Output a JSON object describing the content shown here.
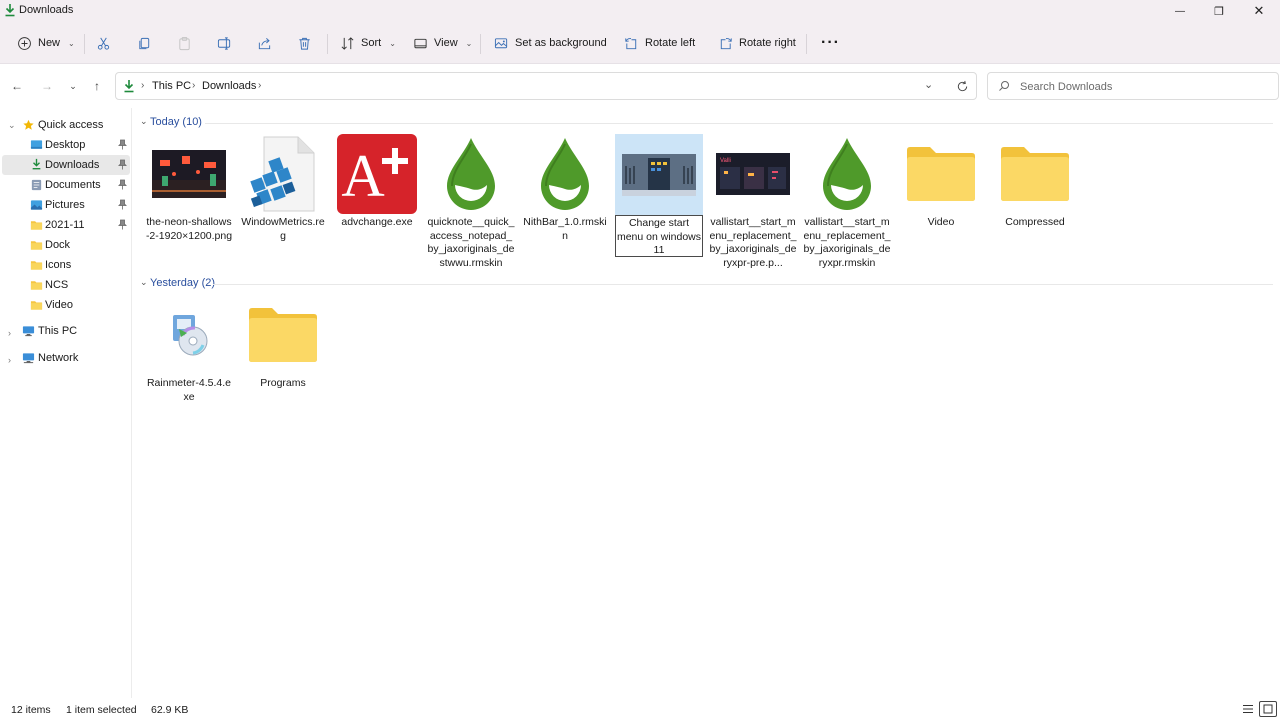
{
  "window": {
    "title": "Downloads",
    "minimize_glyph": "—",
    "maximize_glyph": "❐",
    "close_glyph": "✕"
  },
  "toolbar": {
    "new_label": "New",
    "sort_label": "Sort",
    "view_label": "View",
    "set_background_label": "Set as background",
    "rotate_left_label": "Rotate left",
    "rotate_right_label": "Rotate right",
    "more_label": "···"
  },
  "address": {
    "crumbs": [
      "This PC",
      "Downloads"
    ],
    "search_placeholder": "Search Downloads"
  },
  "sidebar": {
    "quick_access": "Quick access",
    "items": [
      {
        "label": "Desktop",
        "icon": "desktop-icon",
        "pinned": true
      },
      {
        "label": "Downloads",
        "icon": "downloads-icon",
        "pinned": true,
        "selected": true
      },
      {
        "label": "Documents",
        "icon": "documents-icon",
        "pinned": true
      },
      {
        "label": "Pictures",
        "icon": "pictures-icon",
        "pinned": true
      },
      {
        "label": "2021-11",
        "icon": "folder-icon",
        "pinned": true
      },
      {
        "label": "Dock",
        "icon": "folder-icon",
        "pinned": false
      },
      {
        "label": "Icons",
        "icon": "folder-icon",
        "pinned": false
      },
      {
        "label": "NCS",
        "icon": "folder-icon",
        "pinned": false
      },
      {
        "label": "Video",
        "icon": "folder-icon",
        "pinned": false
      }
    ],
    "this_pc": "This PC",
    "network": "Network"
  },
  "groups": {
    "today": {
      "label": "Today (10)",
      "files": [
        {
          "name": "the-neon-shallows-2-1920×1200.png",
          "kind": "image-neon"
        },
        {
          "name": "WindowMetrics.reg",
          "kind": "reg"
        },
        {
          "name": "advchange.exe",
          "kind": "adv-exe"
        },
        {
          "name": "quicknote__quick_access_notepad_by_jaxoriginals_destwwu.rmskin",
          "kind": "rmskin"
        },
        {
          "name": "NithBar_1.0.rmskin",
          "kind": "rmskin"
        },
        {
          "name": "Change start menu on windows 11",
          "kind": "image-startmenu",
          "renaming": true
        },
        {
          "name": "vallistart__start_menu_replacement_by_jaxoriginals_deryxpr-pre.p...",
          "kind": "image-vallistart"
        },
        {
          "name": "vallistart__start_menu_replacement_by_jaxoriginals_deryxpr.rmskin",
          "kind": "rmskin"
        },
        {
          "name": "Video",
          "kind": "folder"
        },
        {
          "name": "Compressed",
          "kind": "folder"
        }
      ]
    },
    "yesterday": {
      "label": "Yesterday (2)",
      "files": [
        {
          "name": "Rainmeter-4.5.4.exe",
          "kind": "installer"
        },
        {
          "name": "Programs",
          "kind": "folder"
        }
      ]
    }
  },
  "status": {
    "item_count": "12 items",
    "selection": "1 item selected",
    "size": "62.9 KB"
  },
  "colors": {
    "accent": "#2a4f9e",
    "folder": "#f9d65c",
    "rmskin_green": "#4f9a2a",
    "adv_red": "#d6232a",
    "selection": "#cce4f7"
  }
}
